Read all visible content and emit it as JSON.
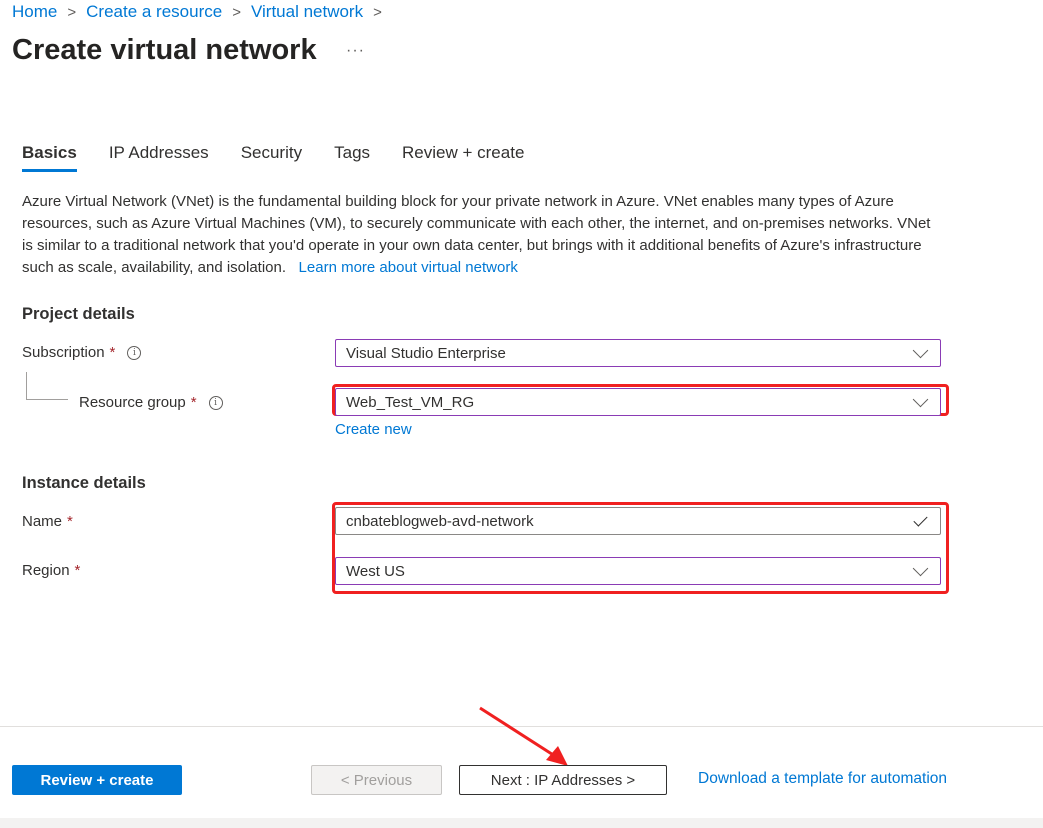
{
  "breadcrumb": [
    "Home",
    "Create a resource",
    "Virtual network"
  ],
  "page": {
    "title": "Create virtual network",
    "more_label": "···"
  },
  "tabs": [
    {
      "label": "Basics",
      "active": true
    },
    {
      "label": "IP Addresses",
      "active": false
    },
    {
      "label": "Security",
      "active": false
    },
    {
      "label": "Tags",
      "active": false
    },
    {
      "label": "Review + create",
      "active": false
    }
  ],
  "description": {
    "text": "Azure Virtual Network (VNet) is the fundamental building block for your private network in Azure. VNet enables many types of Azure resources, such as Azure Virtual Machines (VM), to securely communicate with each other, the internet, and on-premises networks. VNet is similar to a traditional network that you'd operate in your own data center, but brings with it additional benefits of Azure's infrastructure such as scale, availability, and isolation.",
    "link": "Learn more about virtual network"
  },
  "project_details": {
    "heading": "Project details",
    "subscription": {
      "label": "Subscription",
      "required": "*",
      "value": "Visual Studio Enterprise"
    },
    "resource_group": {
      "label": "Resource group",
      "required": "*",
      "value": "Web_Test_VM_RG",
      "create_new": "Create new"
    }
  },
  "instance_details": {
    "heading": "Instance details",
    "name": {
      "label": "Name",
      "required": "*",
      "value": "cnbateblogweb-avd-network"
    },
    "region": {
      "label": "Region",
      "required": "*",
      "value": "West US"
    }
  },
  "footer": {
    "review_create": "Review + create",
    "previous": "< Previous",
    "next": "Next : IP Addresses >",
    "download_template": "Download a template for automation"
  },
  "colors": {
    "accent": "#0078d4",
    "annotation": "#f02020",
    "field_border": "#8a3bb5"
  }
}
